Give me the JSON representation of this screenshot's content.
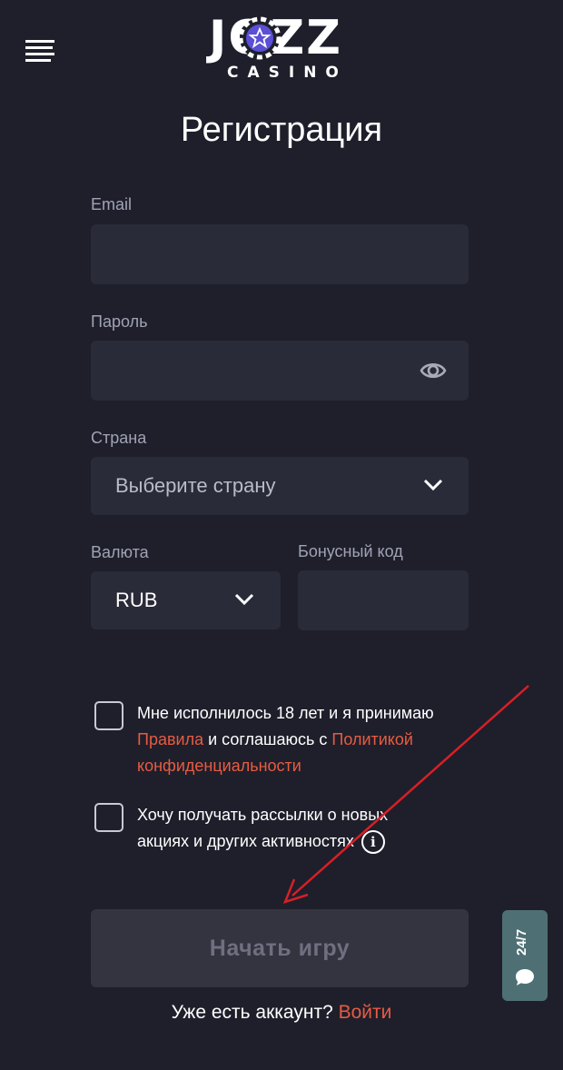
{
  "header": {
    "logo_word": "JOZZ",
    "logo_sub": "CASINO"
  },
  "page_title": "Регистрация",
  "form": {
    "email_label": "Email",
    "email_value": "",
    "password_label": "Пароль",
    "password_value": "",
    "country_label": "Страна",
    "country_placeholder": "Выберите страну",
    "currency_label": "Валюта",
    "currency_value": "RUB",
    "bonus_label": "Бонусный код",
    "bonus_value": ""
  },
  "agreements": {
    "age_text_1": "Мне исполнилось 18 лет и я принимаю",
    "rules_link": "Правила",
    "age_text_2": " и соглашаюсь с ",
    "policy_link": "Политикой конфиденциальности",
    "newsletter_text": "Хочу получать рассылки о новых акциях и других активностях"
  },
  "start_button": "Начать игру",
  "login": {
    "prompt": "Уже есть аккаунт? ",
    "link": "Войти"
  },
  "support": {
    "label": "24/7"
  },
  "colors": {
    "background": "#1e1f2b",
    "field": "#2a2b39",
    "accent_link": "#e85b42",
    "button_disabled": "#33343f",
    "support": "#4e7075",
    "logo_chip": "#5b4fd6"
  }
}
